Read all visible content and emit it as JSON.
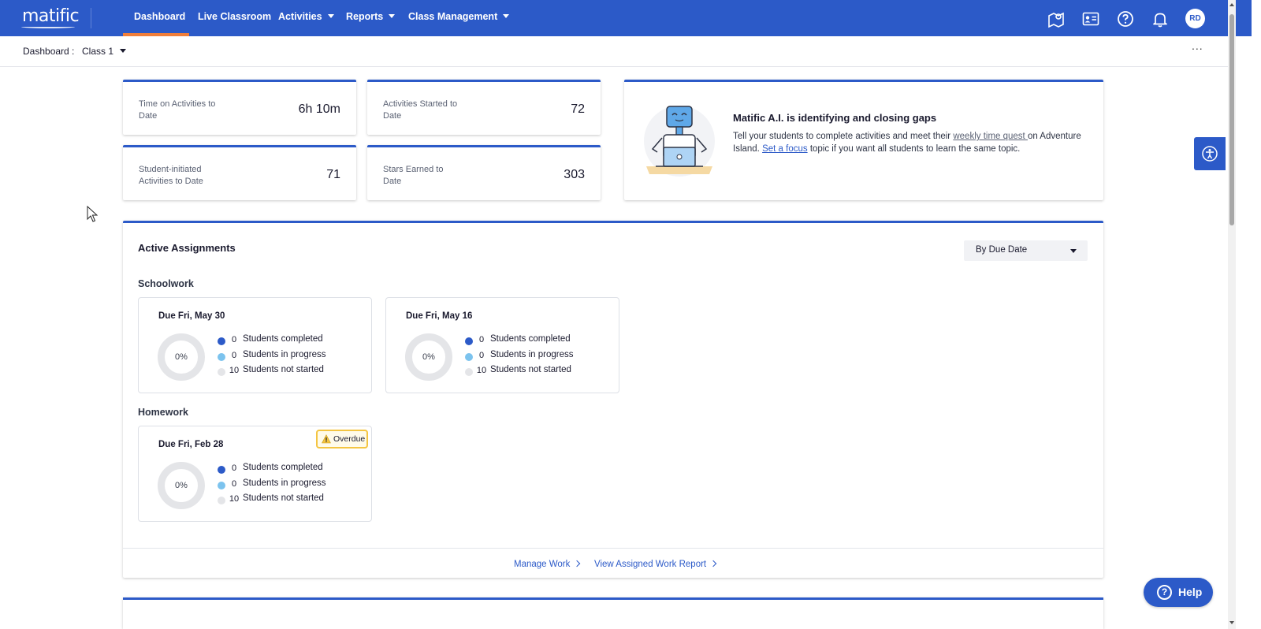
{
  "brand": {
    "logo_text": "matific"
  },
  "nav": {
    "items": [
      {
        "label": "Dashboard",
        "active": true,
        "dropdown": false
      },
      {
        "label": "Live Classroom",
        "active": false,
        "dropdown": false
      },
      {
        "label": "Activities",
        "active": false,
        "dropdown": true
      },
      {
        "label": "Reports",
        "active": false,
        "dropdown": true
      },
      {
        "label": "Class Management",
        "active": false,
        "dropdown": true
      }
    ],
    "icons": [
      "map-icon",
      "id-card-icon",
      "help-circle-icon",
      "bell-icon"
    ],
    "avatar_initials": "RD",
    "accent_color": "#2c5ac8",
    "active_indicator_color": "#f07e3a"
  },
  "subheader": {
    "breadcrumb_label": "Dashboard :",
    "class_selected": "Class 1",
    "more_label": "..."
  },
  "stats": [
    {
      "label": "Time on Activities to Date",
      "value": "6h 10m"
    },
    {
      "label": "Activities Started to Date",
      "value": "72"
    },
    {
      "label": "Student-initiated Activities to Date",
      "value": "71"
    },
    {
      "label": "Stars Earned to Date",
      "value": "303"
    }
  ],
  "ai_card": {
    "title": "Matific A.I. is identifying and closing gaps",
    "text_1": "Tell your students to complete activities and meet their ",
    "link_1": "weekly time quest ",
    "text_2": "on Adventure Island. ",
    "link_2": "Set a focus",
    "text_3": " topic if you want all students to learn the same topic."
  },
  "assignments": {
    "title": "Active Assignments",
    "sort_selected": "By Due Date",
    "legend_colors": {
      "completed": "#2c5ac8",
      "in_progress": "#7cc3ee",
      "not_started": "#e4e5e8"
    },
    "sections": [
      {
        "label": "Schoolwork",
        "cards": [
          {
            "due": "Due Fri, May 30",
            "percent": "0%",
            "completed": "0",
            "in_progress": "0",
            "not_started": "10",
            "overdue": false
          },
          {
            "due": "Due Fri, May 16",
            "percent": "0%",
            "completed": "0",
            "in_progress": "0",
            "not_started": "10",
            "overdue": false
          }
        ]
      },
      {
        "label": "Homework",
        "cards": [
          {
            "due": "Due Fri, Feb 28",
            "percent": "0%",
            "completed": "0",
            "in_progress": "0",
            "not_started": "10",
            "overdue": true,
            "overdue_label": "Overdue"
          }
        ]
      }
    ],
    "legend_labels": {
      "completed": "Students completed",
      "in_progress": "Students in progress",
      "not_started": "Students not started"
    },
    "footer_links": [
      "Manage Work",
      "View Assigned Work Report"
    ]
  },
  "help": {
    "label": "Help"
  }
}
